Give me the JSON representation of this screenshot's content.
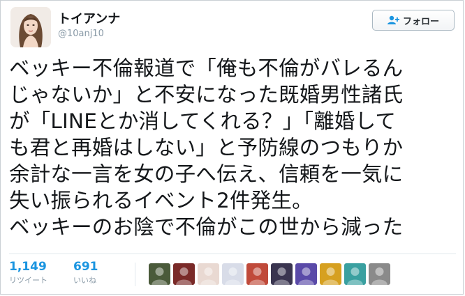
{
  "user": {
    "display_name": "トイアンナ",
    "handle": "@10anj10",
    "avatar_icon": "profile-photo-icon"
  },
  "follow_button": {
    "label": "フォロー",
    "icon": "user-plus-icon"
  },
  "tweet": {
    "lines": [
      "ベッキー不倫報道で「俺も不倫がバレるん",
      "じゃないか」と不安になった既婚男性諸氏",
      "が「LINEとか消してくれる？」「離婚して",
      "も君と再婚はしない」と予防線のつもりか",
      "余計な一言を女の子へ伝え、信頼を一気に",
      "失い振られるイベント2件発生。",
      "ベッキーのお陰で不倫がこの世から減った"
    ]
  },
  "stats": {
    "retweets": {
      "count": "1,149",
      "label": "リツイート"
    },
    "likes": {
      "count": "691",
      "label": "いいね"
    }
  },
  "likers": [
    {
      "icon": "liker-avatar-1",
      "color": "#4a5a3a"
    },
    {
      "icon": "liker-avatar-2",
      "color": "#7a2a28"
    },
    {
      "icon": "liker-avatar-3",
      "color": "#e9d9d2"
    },
    {
      "icon": "liker-avatar-4",
      "color": "#d8dce8"
    },
    {
      "icon": "liker-avatar-5",
      "color": "#c04a3a"
    },
    {
      "icon": "liker-avatar-6",
      "color": "#3a3550"
    },
    {
      "icon": "liker-avatar-7",
      "color": "#5a4aa8"
    },
    {
      "icon": "liker-avatar-8",
      "color": "#d6a020"
    },
    {
      "icon": "liker-avatar-9",
      "color": "#3aa0a0"
    },
    {
      "icon": "liker-avatar-10",
      "color": "#8a8a8a"
    }
  ],
  "colors": {
    "accent": "#1b95e0",
    "text": "#14171a",
    "muted": "#8899a6"
  }
}
